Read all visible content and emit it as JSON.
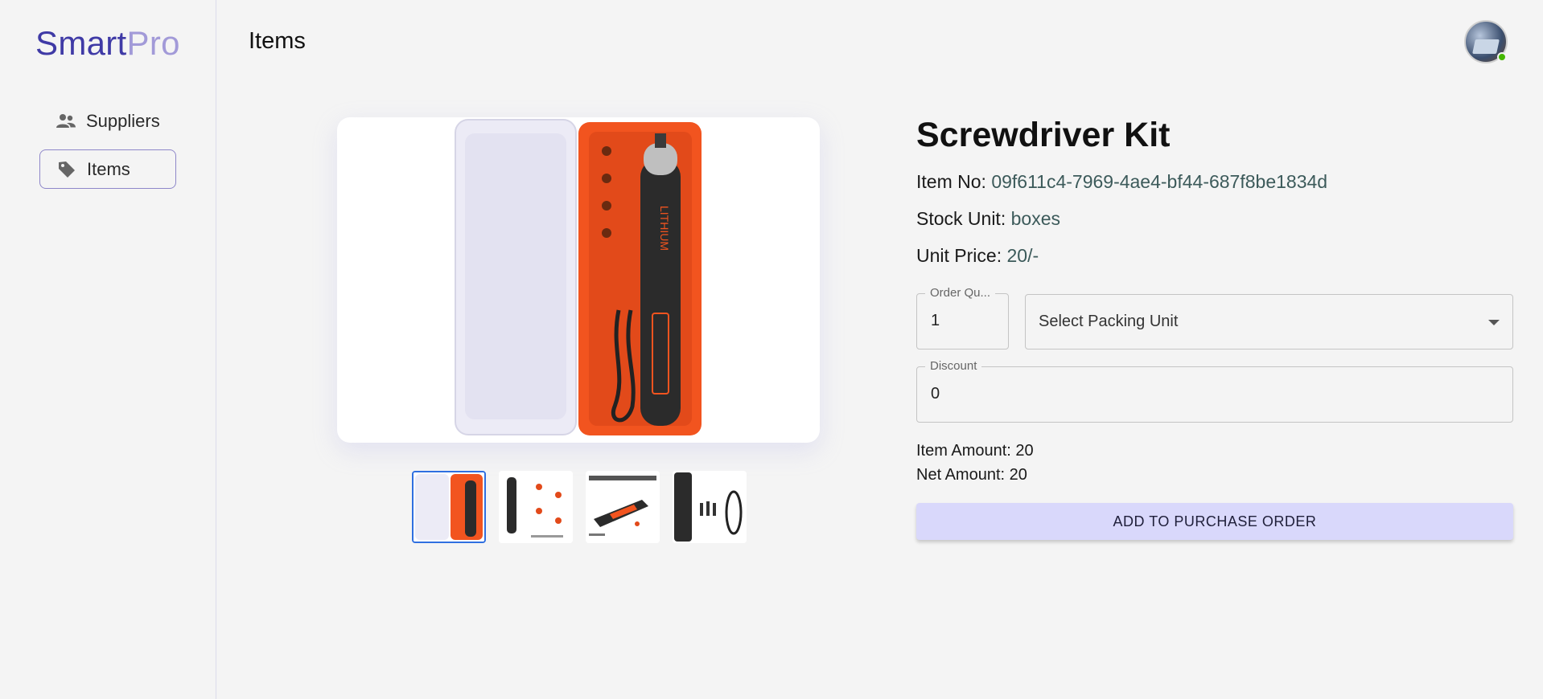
{
  "brand": {
    "part1": "Smart",
    "part2": "Pro"
  },
  "sidebar": {
    "items": [
      {
        "label": "Suppliers",
        "icon": "people-icon",
        "active": false
      },
      {
        "label": "Items",
        "icon": "tag-icon",
        "active": true
      }
    ]
  },
  "header": {
    "title": "Items"
  },
  "user": {
    "avatar_icon": "avatar",
    "online": true
  },
  "gallery": {
    "selected_index": 0,
    "thumbnails": [
      "thumbnail-1",
      "thumbnail-2",
      "thumbnail-3",
      "thumbnail-4"
    ]
  },
  "product": {
    "title": "Screwdriver Kit",
    "item_no_label": "Item No:",
    "item_no": "09f611c4-7969-4ae4-bf44-687f8be1834d",
    "stock_unit_label": "Stock Unit:",
    "stock_unit": "boxes",
    "unit_price_label": "Unit Price:",
    "unit_price": "20/-"
  },
  "form": {
    "order_qty_label": "Order Qu...",
    "order_qty_value": "1",
    "packing_unit_placeholder": "Select Packing Unit",
    "discount_label": "Discount",
    "discount_value": "0"
  },
  "totals": {
    "item_amount_text": "Item Amount: 20",
    "net_amount_text": "Net Amount: 20"
  },
  "actions": {
    "add_label": "ADD TO PURCHASE ORDER"
  },
  "colors": {
    "brand_primary": "#3f3aa6",
    "brand_secondary": "#a29ad8",
    "button_bg": "#d9d8fb",
    "accent_selected": "#2f6fe0",
    "online": "#44b700"
  }
}
